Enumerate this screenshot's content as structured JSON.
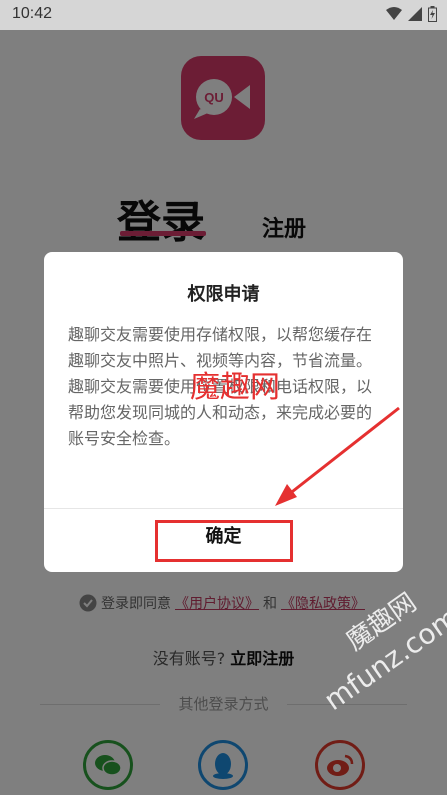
{
  "status_bar": {
    "time": "10:42",
    "icons": [
      "wifi-icon",
      "signal-icon",
      "battery-icon"
    ]
  },
  "login_screen": {
    "tab_login": "登录",
    "tab_register": "注册",
    "agree_prefix": "登录即同意",
    "user_agreement": "《用户协议》",
    "and": "和",
    "privacy_policy": "《隐私政策》",
    "no_account": "没有账号?",
    "register_now": "立即注册",
    "other_login": "其他登录方式",
    "social_icons": [
      "wechat-icon",
      "qq-icon",
      "weibo-icon"
    ]
  },
  "dialog": {
    "title": "权限申请",
    "paragraph1": "趣聊交友需要使用存储权限，以帮您缓存在趣聊交友中照片、视频等内容，节省流量。",
    "paragraph2": "趣聊交友需要使用位置权限和电话权限，以帮助您发现同城的人和动态，来完成必要的账号安全检查。",
    "confirm_label": "确定"
  },
  "watermarks": {
    "center": "魔趣网",
    "corner_en": "mfunz.com",
    "corner_cn": "魔趣网"
  },
  "colors": {
    "brand": "#d83b6a",
    "annotation": "#e53030",
    "wechat": "#2fa33a",
    "qq": "#1f8fe0",
    "weibo": "#e23a2c"
  }
}
